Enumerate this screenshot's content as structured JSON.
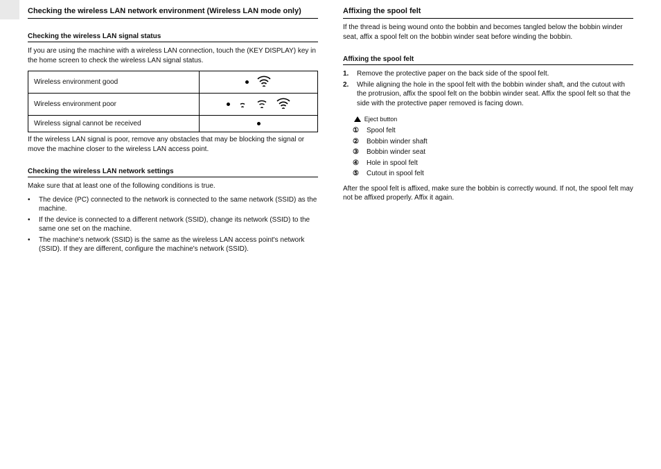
{
  "left": {
    "h1": "Checking the wireless LAN network environment (Wireless LAN mode only)",
    "sub1_title": "Checking the wireless LAN signal status",
    "sub1_p1": "If you are using the machine with a wireless LAN connection, touch the  (KEY DISPLAY) key in the home screen to check the wireless LAN signal status.",
    "tbl": {
      "r1_label": "Wireless environment good",
      "r2_label": "Wireless environment poor",
      "r3_label": "Wireless signal cannot be received"
    },
    "sub1_p2": "If the wireless LAN signal is poor, remove any obstacles that may be blocking the signal or move the machine closer to the wireless LAN access point.",
    "sub2_title": "Checking the wireless LAN network settings",
    "sub2_p1": "Make sure that at least one of the following conditions is true.",
    "sub2_bullets": [
      "The device (PC) connected to the network is connected to the same network (SSID) as the machine.",
      "If the device is connected to a different network (SSID), change its network (SSID) to the same one set on the machine.",
      "The machine's network (SSID) is the same as the wireless LAN access point's network (SSID). If they are different, configure the machine's network (SSID)."
    ]
  },
  "right": {
    "h1": "Affixing the spool felt",
    "p0": "If the thread is being wound onto the bobbin and becomes tangled below the bobbin winder seat, affix a spool felt on the bobbin winder seat before winding the bobbin.",
    "sub_title": "Affixing the spool felt",
    "steps": [
      "Remove the protective paper on the back side of the spool felt.",
      "While aligning the hole in the spool felt with the bobbin winder shaft, and the cutout with the protrusion, affix the spool felt on the bobbin winder seat. Affix the spool felt so that the side with the protective paper removed is facing down."
    ],
    "legend_eject": "Eject button",
    "legend": [
      "Spool felt",
      "Bobbin winder shaft",
      "Bobbin winder seat",
      "Hole in spool felt",
      "Cutout in spool felt"
    ],
    "note": "After the spool felt is affixed, make sure the bobbin is correctly wound. If not, the spool felt may not be affixed properly. Affix it again."
  }
}
